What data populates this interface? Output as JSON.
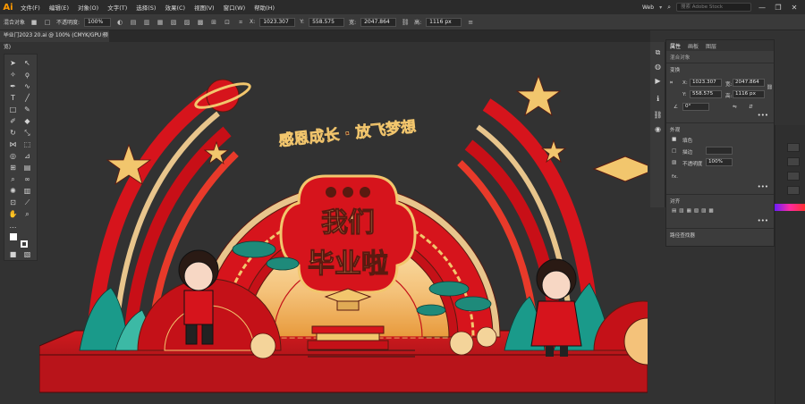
{
  "app": {
    "logo": "Ai",
    "menus": [
      "文件(F)",
      "编辑(E)",
      "对象(O)",
      "文字(T)",
      "选择(S)",
      "效果(C)",
      "视图(V)",
      "窗口(W)",
      "帮助(H)"
    ],
    "workspace": "Web",
    "search_placeholder": "搜索 Adobe Stock",
    "win_minimize": "—",
    "win_restore": "❐",
    "win_close": "✕"
  },
  "control_bar": {
    "selection_label": "混合对象",
    "opacity_label": "不透明度:",
    "opacity_value": "100%",
    "x_label": "X:",
    "x_value": "1023.307",
    "y_label": "Y:",
    "y_value": "558.575",
    "w_label": "宽:",
    "w_value": "2047.864",
    "h_label": "高:",
    "h_value": "1116 px"
  },
  "document": {
    "tab_title": "毕业门2023  20.ai @ 100% (CMYK/GPU 预览)",
    "tab_close": "×"
  },
  "artwork": {
    "banner_text": "感恩成长 · 放飞梦想",
    "title_line1": "我们",
    "title_line2": "毕业啦"
  },
  "properties_panel": {
    "tabs": [
      "属性",
      "画板",
      "图层"
    ],
    "object_type": "混合对象",
    "transform_heading": "变换",
    "x_label": "X:",
    "x_value": "1023.307",
    "y_label": "Y:",
    "y_value": "558.575",
    "w_label": "宽:",
    "w_value": "2047.864",
    "h_label": "高:",
    "h_value": "1116 px",
    "angle_value": "0°",
    "appearance_heading": "外观",
    "fill_label": "填色",
    "stroke_label": "描边",
    "opacity_label": "不透明度",
    "opacity_value": "100%",
    "fx_label": "fx.",
    "align_heading": "对齐",
    "path_finder_heading": "路径查找器",
    "more": "•••"
  },
  "colors": {
    "accent_red": "#d6141c",
    "gold": "#f2c66d",
    "ui_dark": "#323232"
  }
}
